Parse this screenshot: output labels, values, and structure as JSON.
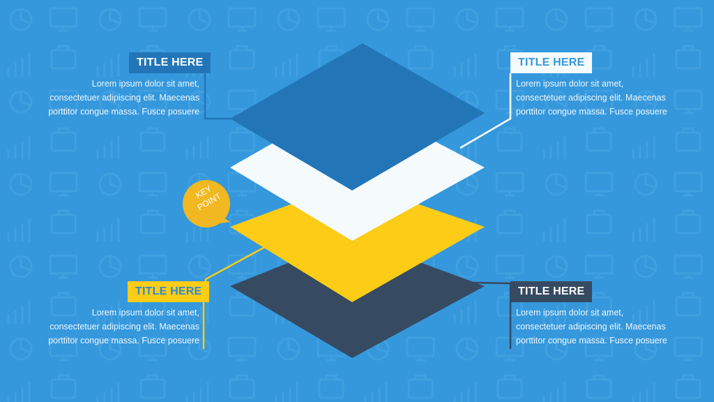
{
  "colors": {
    "background": "#3598dc",
    "layer_top": "#2276b8",
    "layer_white": "#f5fafd",
    "layer_yellow": "#fccc16",
    "layer_bottom": "#364a62",
    "key_point": "#f1b821"
  },
  "callouts": {
    "top_left": {
      "title": "TITLE HERE",
      "lines": [
        "Lorem ipsum dolor sit amet,",
        "consectetuer adipiscing  elit. Maecenas",
        "porttitor congue massa. Fusce posuere"
      ]
    },
    "top_right": {
      "title": "TITLE HERE",
      "lines": [
        "Lorem ipsum dolor sit amet,",
        "consectetuer adipiscing  elit. Maecenas",
        "porttitor congue massa. Fusce posuere"
      ]
    },
    "bottom_left": {
      "title": "TITLE HERE",
      "lines": [
        "Lorem ipsum dolor sit amet,",
        "consectetuer adipiscing  elit. Maecenas",
        "porttitor congue massa. Fusce posuere"
      ]
    },
    "bottom_right": {
      "title": "TITLE HERE",
      "lines": [
        "Lorem ipsum dolor sit amet,",
        "consectetuer adipiscing  elit. Maecenas",
        "porttitor congue massa. Fusce posuere"
      ]
    }
  },
  "key_point": {
    "line1": "KEY",
    "line2": "POINT"
  }
}
